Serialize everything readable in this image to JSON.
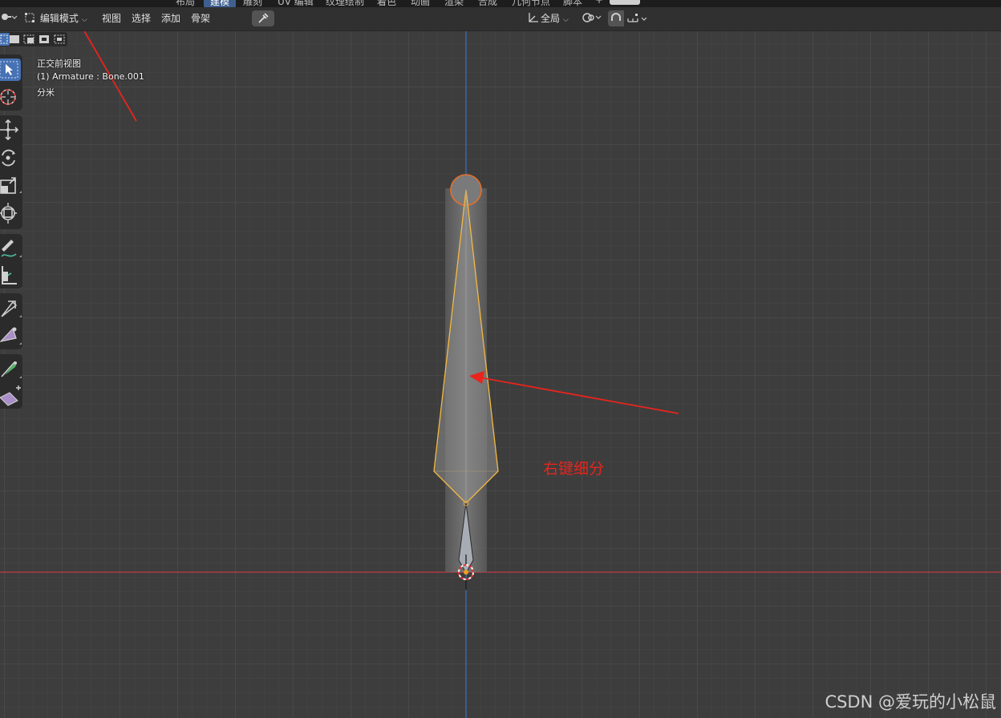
{
  "tabs": [
    "布局",
    "建模",
    "雕刻",
    "UV 编辑",
    "纹理绘制",
    "着色",
    "动画",
    "渲染",
    "合成",
    "几何节点",
    "脚本",
    "+"
  ],
  "header": {
    "mode_label": "编辑模式",
    "menus": [
      "视图",
      "选择",
      "添加",
      "骨架"
    ],
    "transform_orientation": "全局"
  },
  "overlay": {
    "view_name": "正交前视图",
    "object_info": "(1) Armature : Bone.001",
    "units": "分米"
  },
  "annotation": {
    "text": "右键细分",
    "color": "#e8241d"
  },
  "watermark": "CSDN @爱玩的小松鼠",
  "icons": [
    "select-box-icon",
    "cursor-icon",
    "move-icon",
    "rotate-icon",
    "scale-icon",
    "transform-icon",
    "annotate-icon",
    "measure-icon",
    "bone-size-icon",
    "bone-envelope-icon",
    "roll-icon",
    "extrude-icon"
  ],
  "colors": {
    "grid_bg": "#3d3d3d",
    "x_axis": "#c33b44",
    "z_axis": "#3a6fb5",
    "bone_outline": "#f5b942",
    "head_ring": "#e4702b"
  }
}
